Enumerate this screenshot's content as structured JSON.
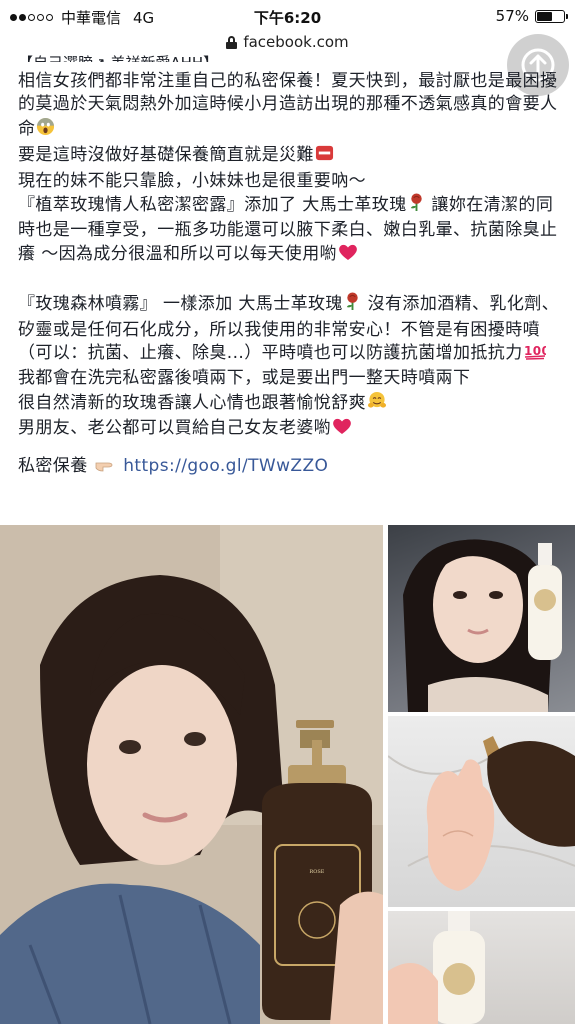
{
  "status_bar": {
    "carrier": "中華電信",
    "network": "4G",
    "time": "下午6:20",
    "battery": "57%",
    "battery_level": 0.57,
    "signal_bars_filled": 2
  },
  "url_bar": {
    "url": "facebook.com"
  },
  "post": {
    "cut_heading": "【自己選膀↗ 美祥新愛AHH】",
    "paragraph1": [
      "相信女孩們都非常注重自己的私密保養！夏天快到，最討厭也是最困擾的莫過於天氣悶熱外加這時候小月造訪出現的那種不透氣感真的會要人命",
      "要是這時沒做好基礎保養簡直就是災難",
      "現在的妹不能只靠臉，小妹妹也是很重要吶～",
      "『植萃玫瑰情人私密潔密露』添加了 大馬士革玫瑰",
      " 讓妳在清潔的同時也是一種享受，一瓶多功能還可以腋下柔白、嫩白乳暈、抗菌除臭止癢 ～因為成分很溫和所以可以每天使用喲"
    ],
    "paragraph2": [
      "『玫瑰森林噴霧』 一樣添加 大馬士革玫瑰",
      " 沒有添加酒精、乳化劑、矽靈或是任何石化成分，所以我使用的非常安心！不管是有困擾時噴（可以：抗菌、止癢、除臭...）平時噴也可以防護抗菌增加抵抗力",
      "我都會在洗完私密露後噴兩下，或是要出門一整天時噴兩下",
      "很自然清新的玫瑰香讓人心情也跟著愉悅舒爽",
      "男朋友、老公都可以買給自己女友老婆喲"
    ],
    "link_label": "私密保養",
    "link_url": "https://goo.gl/TWwZZO"
  },
  "icons": {
    "share": "share-icon",
    "lock": "lock-icon",
    "scream": "scream-emoji-icon",
    "sos": "sos-emoji-icon",
    "rose": "rose-emoji-icon",
    "heart": "heart-emoji-icon",
    "hundred": "hundred-points-emoji-icon",
    "hug": "hugging-face-emoji-icon",
    "pointing": "pointing-right-emoji-icon"
  },
  "colors": {
    "link": "#385898",
    "text": "#1d2129",
    "emoji_heart": "#e0245e",
    "emoji_rose": "#c0392b"
  }
}
